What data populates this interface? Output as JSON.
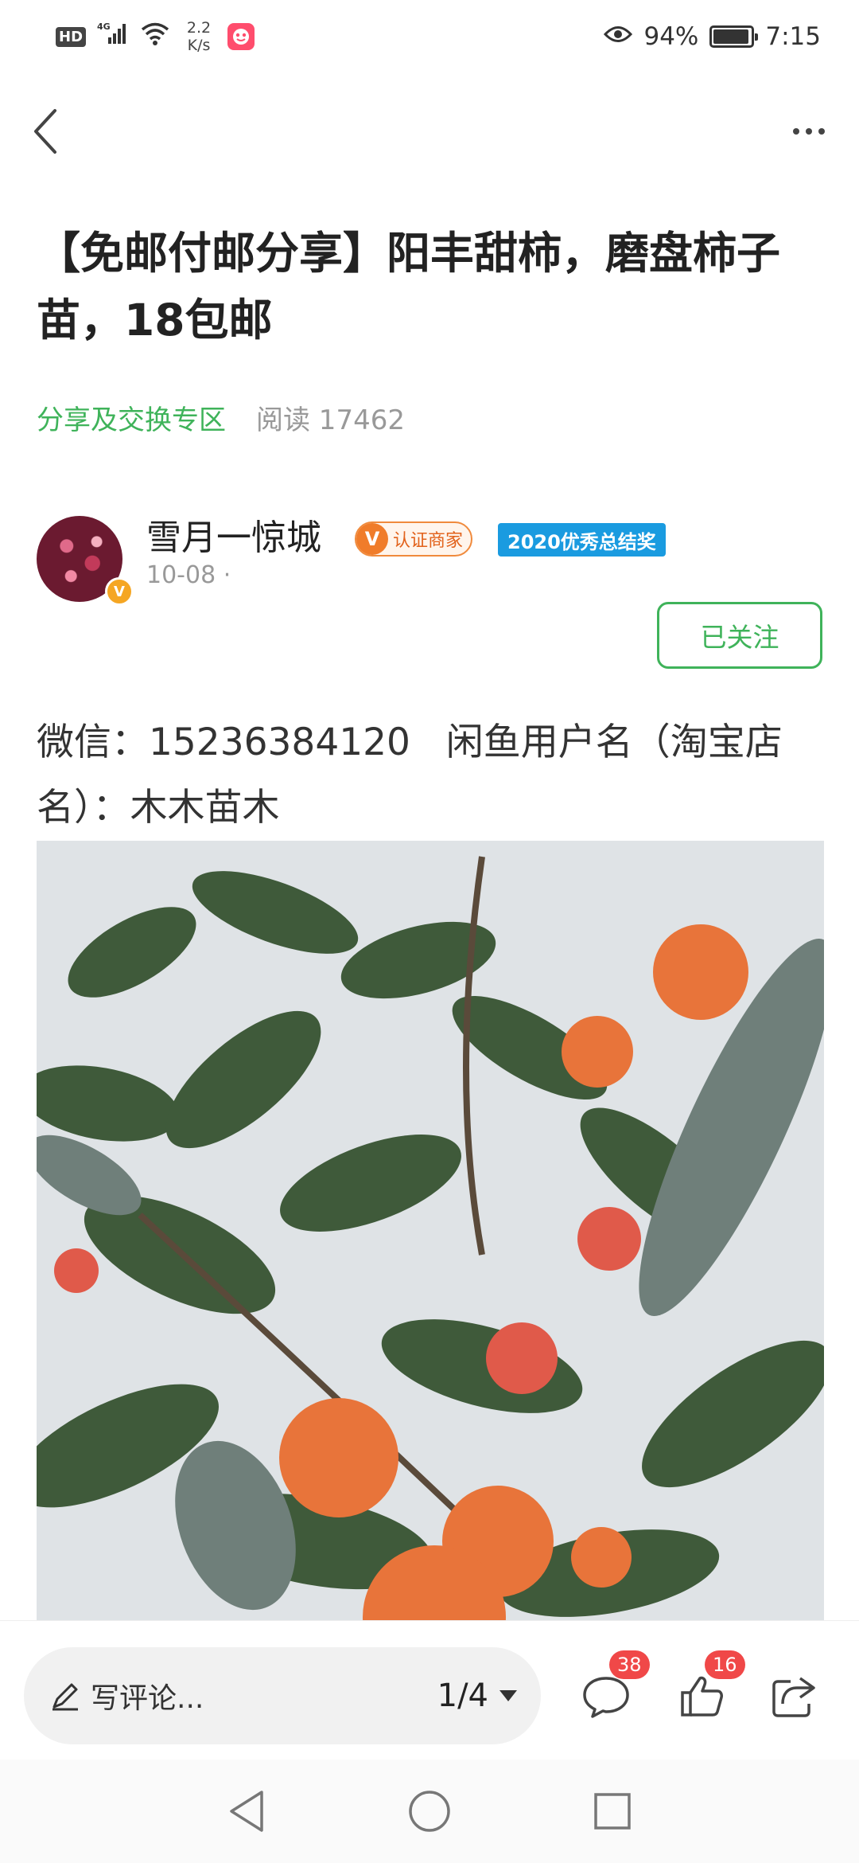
{
  "status_bar": {
    "hd": "HD",
    "network": "4G",
    "speed": "2.2\nK/s",
    "battery": "94%",
    "battery_level": 0.94,
    "time": "7:15"
  },
  "post": {
    "title": "【免邮付邮分享】阳丰甜柿，磨盘柿子苗，18包邮",
    "category": "分享及交换专区",
    "read_label": "阅读 17462"
  },
  "author": {
    "name": "雪月一惊城",
    "verified_badge": "V",
    "merchant_label": "认证商家",
    "award_label": "2020优秀总结奖",
    "date": "10-08 ·",
    "follow_label": "已关注"
  },
  "content": {
    "text": "微信：15236384120   闲鱼用户名（淘宝店名）：木木苗木"
  },
  "bottom_bar": {
    "comment_placeholder": "写评论...",
    "page_indicator": "1/4",
    "comment_count": "38",
    "like_count": "16"
  },
  "colors": {
    "accent_green": "#3fb35a",
    "badge_red": "#f04848",
    "merchant_orange": "#f07c2a",
    "award_blue": "#1a9be0"
  },
  "icons": {
    "back": "chevron-left-icon",
    "more": "more-dots-icon",
    "edit": "pencil-icon",
    "comment": "comment-bubble-icon",
    "like": "thumbs-up-icon",
    "share": "share-icon",
    "dropdown": "triangle-down-icon"
  }
}
